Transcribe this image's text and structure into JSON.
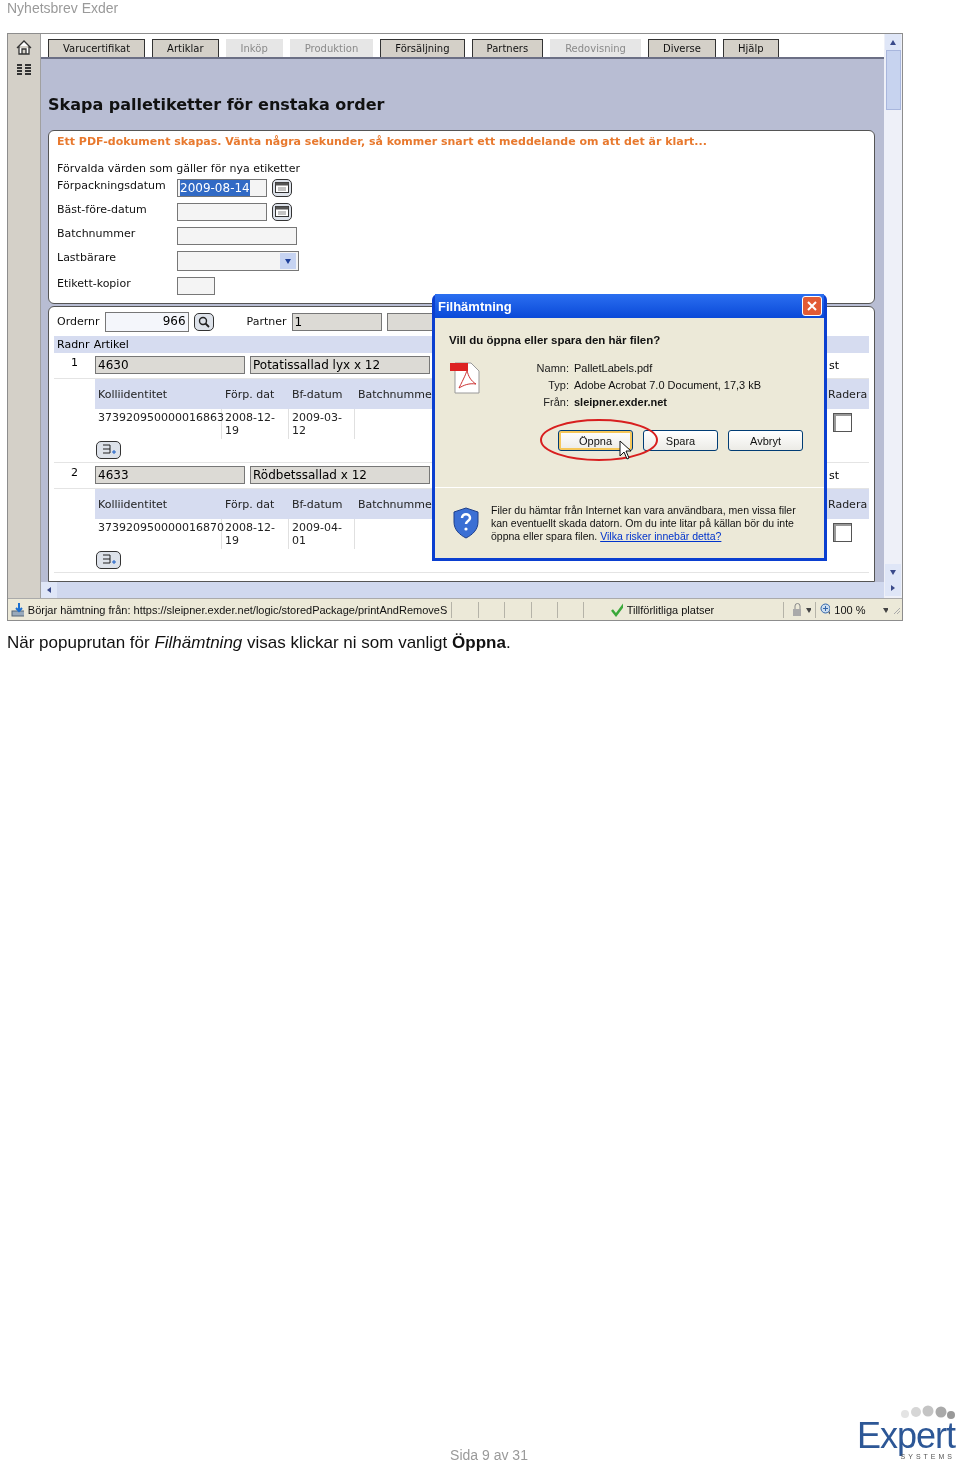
{
  "document_header": "Nyhetsbrev Exder",
  "screenshot": {
    "tabs": [
      {
        "label": "Varucertifikat",
        "disabled": false
      },
      {
        "label": "Artiklar",
        "disabled": false
      },
      {
        "label": "Inköp",
        "disabled": true
      },
      {
        "label": "Produktion",
        "disabled": true
      },
      {
        "label": "Försäljning",
        "disabled": false
      },
      {
        "label": "Partners",
        "disabled": false
      },
      {
        "label": "Redovisning",
        "disabled": true
      },
      {
        "label": "Diverse",
        "disabled": false
      },
      {
        "label": "Hjälp",
        "disabled": false
      }
    ],
    "heading": "Skapa palletiketter för enstaka order",
    "message": "Ett PDF-dokument skapas. Vänta några sekunder, så kommer snart ett meddelande om att det är klart...",
    "defaults_title": "Förvalda värden som gäller för nya etiketter",
    "form_fields": [
      {
        "label": "Förpackningsdatum",
        "kind": "date",
        "value": "2009-08-14",
        "highlighted": true
      },
      {
        "label": "Bäst-före-datum",
        "kind": "date"
      },
      {
        "label": "Batchnummer",
        "kind": "text"
      },
      {
        "label": "Lastbärare",
        "kind": "select"
      },
      {
        "label": "Etikett-kopior",
        "kind": "short"
      }
    ],
    "order": {
      "label": "Ordernr",
      "value": "966",
      "partner_label": "Partner",
      "partner_value": "1"
    },
    "item_header": [
      "Radnr",
      "Artikel"
    ],
    "items": [
      {
        "row": "1",
        "article": "4630",
        "name": "Potatissallad lyx x 12",
        "unit": "st",
        "columns": [
          "Kolliidentitet",
          "Förp. dat",
          "Bf-datum",
          "Batchnumme"
        ],
        "delete_label": "Radera",
        "packages": [
          {
            "id": "373920950000016863",
            "packed": "2008-12-19",
            "best_before": "2009-03-12",
            "checked": false
          }
        ]
      },
      {
        "row": "2",
        "article": "4633",
        "name": "Rödbetssallad x 12",
        "unit": "st",
        "columns": [
          "Kolliidentitet",
          "Förp. dat",
          "Bf-datum",
          "Batchnumme"
        ],
        "delete_label": "Radera",
        "packages": [
          {
            "id": "373920950000016870",
            "packed": "2008-12-19",
            "best_before": "2009-04-01",
            "checked": false
          }
        ]
      }
    ],
    "dialog": {
      "title": "Filhämtning",
      "question": "Vill du öppna eller spara den här filen?",
      "details": [
        {
          "label": "Namn:",
          "value": "PalletLabels.pdf",
          "bold": false
        },
        {
          "label": "Typ:",
          "value": "Adobe Acrobat 7.0 Document, 17,3 kB",
          "bold": false
        },
        {
          "label": "Från:",
          "value": "sleipner.exder.net",
          "bold": true
        }
      ],
      "buttons": [
        {
          "label": "Öppna",
          "focused": true
        },
        {
          "label": "Spara",
          "focused": false
        },
        {
          "label": "Avbryt",
          "focused": false
        }
      ],
      "warning": "Filer du hämtar från Internet kan vara användbara, men vissa filer kan eventuellt skada datorn. Om du inte litar på källan bör du inte öppna eller spara filen.",
      "warning_link": "Vilka risker innebär detta?"
    },
    "status_bar": {
      "message": "Börjar hämtning från: https://sleipner.exder.net/logic/storedPackage/printAndRemoveS",
      "zone": "Tillförlitliga platser",
      "zoom": "100 %"
    }
  },
  "caption": "När popuprutan för *Filhämtning* visas klickar ni som vanligt **Öppna**.",
  "footer": {
    "page": "Sida 9 av 31",
    "logo": "Expert",
    "logo_sub": "SYSTEMS"
  }
}
